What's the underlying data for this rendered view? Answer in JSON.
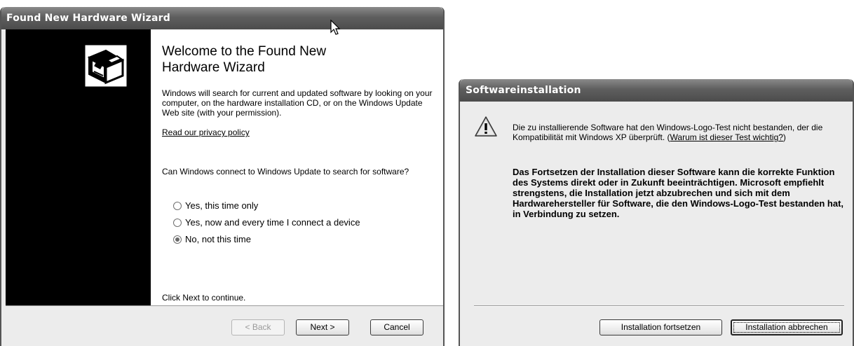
{
  "wizard": {
    "title": "Found New Hardware Wizard",
    "heading": "Welcome to the Found New Hardware Wizard",
    "intro": "Windows will search for current and updated software by looking on your computer, on the hardware installation CD, or on the Windows Update Web site (with your permission).",
    "privacy_link": "Read our privacy policy",
    "question": "Can Windows connect to Windows Update to search for software?",
    "options": [
      {
        "label": "Yes, this time only",
        "selected": false
      },
      {
        "label": "Yes, now and every time I connect a device",
        "selected": false
      },
      {
        "label": "No, not this time",
        "selected": true
      }
    ],
    "continue_text": "Click Next to continue.",
    "back_label": "< Back",
    "next_label": "Next >",
    "cancel_label": "Cancel"
  },
  "dialog": {
    "title": "Softwareinstallation",
    "message_prefix": "Die zu installierende Software hat den Windows-Logo-Test nicht bestanden, der die Kompatibilität mit Windows XP überprüft. (",
    "message_link": "Warum ist dieser Test wichtig?",
    "message_suffix": ")",
    "warning": "Das Fortsetzen der Installation dieser Software kann die korrekte Funktion des Systems direkt oder in Zukunft beeinträchtigen. Microsoft empfiehlt strengstens, die Installation jetzt abzubrechen und sich mit dem Hardwarehersteller für Software, die den Windows-Logo-Test bestanden hat, in Verbindung zu setzen.",
    "continue_label": "Installation fortsetzen",
    "abort_label": "Installation abbrechen"
  },
  "icons": [
    "hardware-wizard-icon",
    "warning-icon",
    "mouse-cursor-icon"
  ]
}
